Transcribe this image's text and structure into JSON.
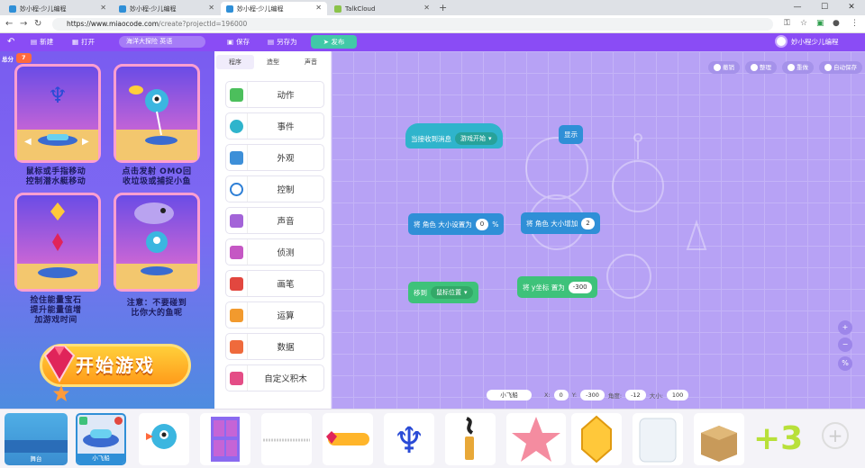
{
  "browser": {
    "tabs": [
      {
        "title": "妙小程-少儿编程",
        "active": false
      },
      {
        "title": "妙小程-少儿编程",
        "active": false
      },
      {
        "title": "妙小程-少儿编程",
        "active": true
      },
      {
        "title": "TalkCloud",
        "active": false
      }
    ],
    "new_tab": "+",
    "url_host": "https://www.miaocode.com",
    "url_path": "/create?projectId=196000"
  },
  "menu": {
    "new": "新建",
    "open": "打开",
    "project_name": "海洋大探险 英语",
    "save": "保存",
    "save_as": "另存为",
    "publish": "发布",
    "user": "妙小程少儿编程"
  },
  "stage": {
    "score_label": "总分",
    "score_value": "7",
    "captions": [
      "鼠标或手指移动\n控制潜水艇移动",
      "点击发射 OMO回\n收垃圾或捕捉小鱼",
      "捡住能量宝石\n提升能量值增\n加游戏时间",
      "注意：不要碰到\n比你大的鱼呢"
    ],
    "start_button": "开始游戏",
    "start_small": "开始"
  },
  "palette": {
    "tabs": [
      "程序",
      "造型",
      "声音"
    ],
    "categories": [
      {
        "label": "动作",
        "color": "#4cbf5c"
      },
      {
        "label": "事件",
        "color": "#2fb4cc"
      },
      {
        "label": "外观",
        "color": "#3d8fd8"
      },
      {
        "label": "控制",
        "color": "#2e7fd6"
      },
      {
        "label": "声音",
        "color": "#a364d8"
      },
      {
        "label": "侦测",
        "color": "#c557c4"
      },
      {
        "label": "画笔",
        "color": "#e2473f"
      },
      {
        "label": "运算",
        "color": "#f29a2e"
      },
      {
        "label": "数据",
        "color": "#ef6a3c"
      },
      {
        "label": "自定义积木",
        "color": "#e44d86"
      }
    ]
  },
  "workspace": {
    "toolbar": {
      "undo": "撤销",
      "tidy": "整理",
      "reset": "重做",
      "autosave": "自动保存"
    },
    "blocks": {
      "when_receive": "当接收到消息",
      "when_receive_msg": "游戏开始",
      "show": "显示",
      "set_size_label": "将 角色 大小设置为",
      "set_size_value": "0",
      "set_size_unit": "%",
      "change_size_label": "将 角色 大小增加",
      "change_size_value": "2",
      "move_to": "移到",
      "move_to_target": "鼠标位置",
      "set_y_label": "将 y坐标 置为",
      "set_y_value": "-300"
    },
    "sprite_info": {
      "name": "小飞船",
      "x_label": "X:",
      "x": "0",
      "y_label": "Y:",
      "y": "-300",
      "dir_label": "角度:",
      "dir": "-12",
      "size_label": "大小:",
      "size": "100"
    },
    "zoom": {
      "in": "+",
      "out": "−",
      "reset": "%"
    }
  },
  "sprites": {
    "stage_label": "舞台",
    "selected_label": "小飞船",
    "count_badge": "+3",
    "add": "+"
  }
}
